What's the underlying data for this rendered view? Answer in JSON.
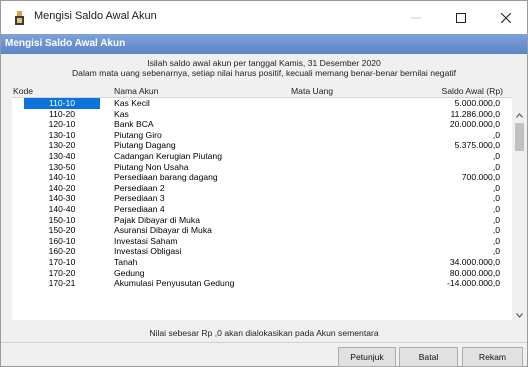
{
  "window": {
    "title": "Mengisi Saldo Awal Akun"
  },
  "header": {
    "title": "Mengisi Saldo Awal Akun"
  },
  "info": {
    "line1": "Isilah saldo awal akun per tanggal Kamis, 31 Desember 2020",
    "line2": "Dalam mata uang sebenarnya, setiap nilai harus positif, kecuali memang benar-benar bernilai negatif"
  },
  "table": {
    "headers": {
      "kode": "Kode",
      "nama": "Nama Akun",
      "mata_uang": "Mata Uang",
      "saldo": "Saldo Awal (Rp)"
    },
    "rows": [
      {
        "kode": "110-10",
        "nama": "Kas Kecil",
        "saldo": "5.000.000,0"
      },
      {
        "kode": "110-20",
        "nama": "Kas",
        "saldo": "11.286.000,0"
      },
      {
        "kode": "120-10",
        "nama": "Bank BCA",
        "saldo": "20.000.000,0"
      },
      {
        "kode": "130-10",
        "nama": "Piutang Giro",
        "saldo": ",0"
      },
      {
        "kode": "130-20",
        "nama": "Piutang Dagang",
        "saldo": "5.375.000,0"
      },
      {
        "kode": "130-40",
        "nama": "Cadangan Kerugian Piutang",
        "saldo": ",0"
      },
      {
        "kode": "130-50",
        "nama": "Piutang Non Usaha",
        "saldo": ",0"
      },
      {
        "kode": "140-10",
        "nama": "Persediaan barang dagang",
        "saldo": "700.000,0"
      },
      {
        "kode": "140-20",
        "nama": "Persediaan 2",
        "saldo": ",0"
      },
      {
        "kode": "140-30",
        "nama": "Persediaan 3",
        "saldo": ",0"
      },
      {
        "kode": "140-40",
        "nama": "Persediaan 4",
        "saldo": ",0"
      },
      {
        "kode": "150-10",
        "nama": "Pajak Dibayar di Muka",
        "saldo": ",0"
      },
      {
        "kode": "150-20",
        "nama": "Asuransi Dibayar di Muka",
        "saldo": ",0"
      },
      {
        "kode": "160-10",
        "nama": "Investasi Saham",
        "saldo": ",0"
      },
      {
        "kode": "160-20",
        "nama": "Investasi Obligasi",
        "saldo": ",0"
      },
      {
        "kode": "170-10",
        "nama": "Tanah",
        "saldo": "34.000.000,0"
      },
      {
        "kode": "170-20",
        "nama": "Gedung",
        "saldo": "80.000.000,0"
      },
      {
        "kode": "170-21",
        "nama": "Akumulasi Penyusutan Gedung",
        "saldo": "-14.000.000,0"
      }
    ],
    "selected_row": 0
  },
  "note": "Nilai sebesar Rp ,0 akan dialokasikan pada Akun sementara",
  "buttons": {
    "petunjuk": "Petunjuk",
    "batal": "Batal",
    "rekam": "Rekam"
  },
  "colors": {
    "header_bar": "#6b8fcf",
    "selection": "#0a74da"
  }
}
